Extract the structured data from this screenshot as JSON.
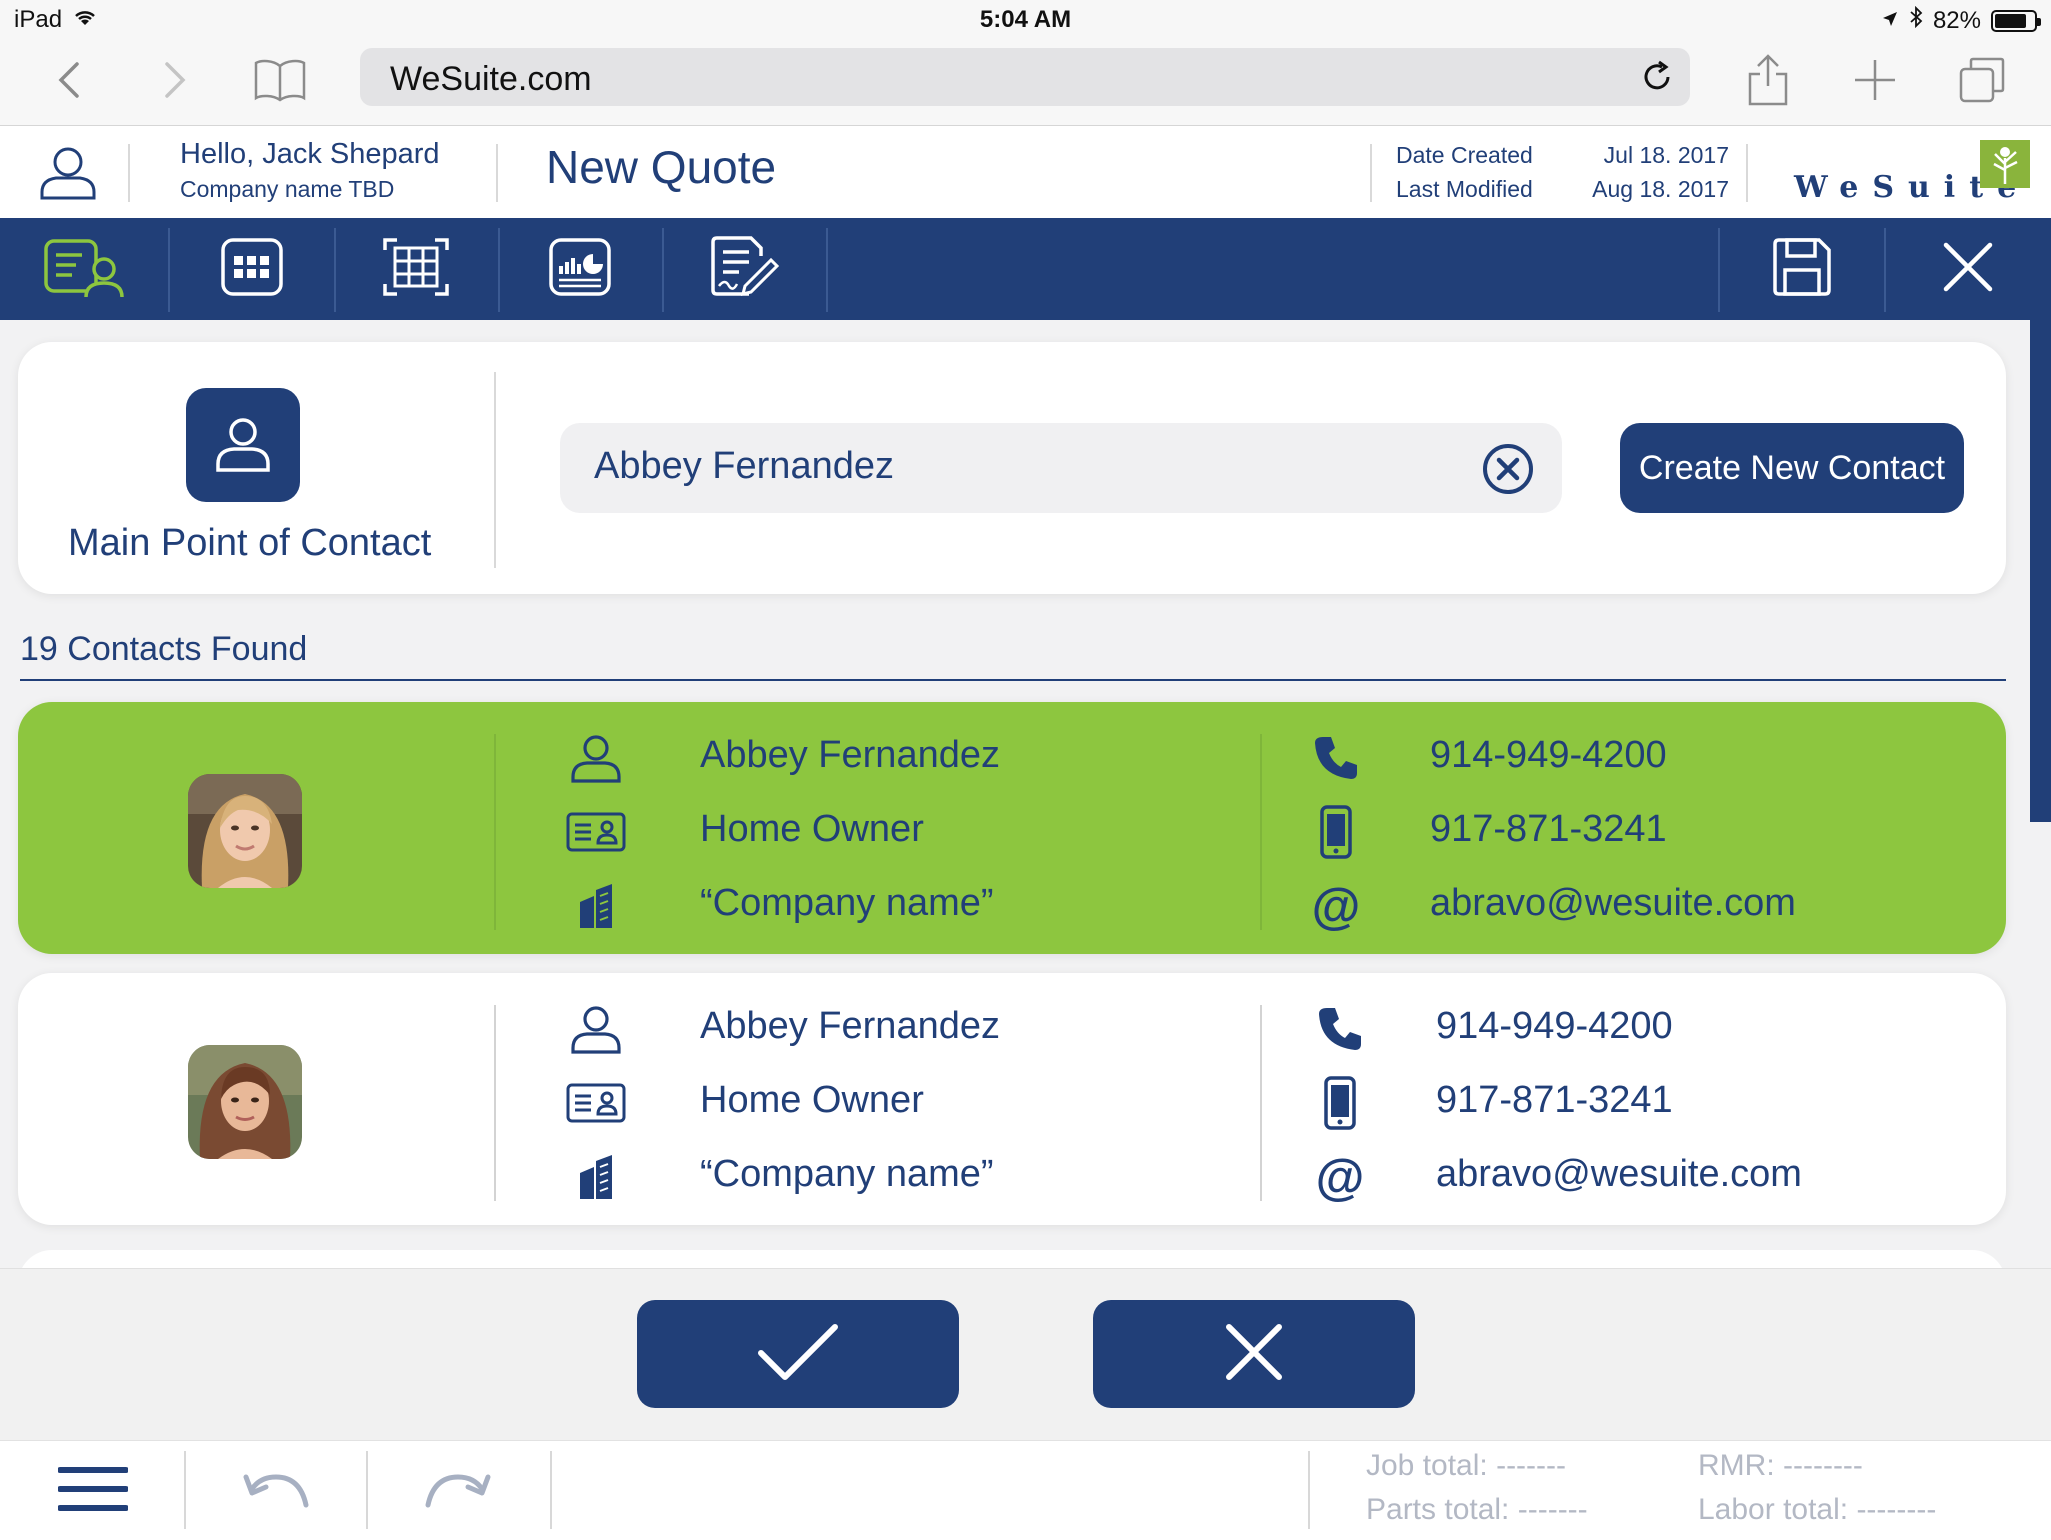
{
  "status_bar": {
    "device": "iPad",
    "time": "5:04 AM",
    "battery": "82%",
    "battery_level": 0.82
  },
  "browser": {
    "url": "WeSuite.com"
  },
  "header": {
    "greeting": "Hello, Jack Shepard",
    "company": "Company name TBD",
    "title": "New Quote",
    "date_created_label": "Date Created",
    "date_created_value": "Jul 18. 2017",
    "last_modified_label": "Last Modified",
    "last_modified_value": "Aug 18. 2017",
    "logo_text": "WeSuite"
  },
  "toolbar": {
    "items": [
      "contact-icon",
      "grid-icon",
      "table-icon",
      "report-icon",
      "sign-document-icon"
    ],
    "save": "save-icon",
    "close": "close-icon"
  },
  "contact_section": {
    "label": "Main Point of Contact",
    "search_value": "Abbey Fernandez",
    "create_button": "Create New Contact"
  },
  "results": {
    "count_text": "19 Contacts Found",
    "contacts": [
      {
        "name": "Abbey Fernandez",
        "role": "Home Owner",
        "company": "“Company name”",
        "phone": "914-949-4200",
        "mobile": "917-871-3241",
        "email": "abravo@wesuite.com",
        "selected": true
      },
      {
        "name": "Abbey Fernandez",
        "role": "Home Owner",
        "company": "“Company name”",
        "phone": "914-949-4200",
        "mobile": "917-871-3241",
        "email": "abravo@wesuite.com",
        "selected": false
      }
    ]
  },
  "footer": {
    "job_total": "Job total: -------",
    "parts_total": "Parts total: -------",
    "rmr": "RMR: --------",
    "labor_total": "Labor total: --------"
  },
  "colors": {
    "navy": "#213f78",
    "selected_green": "#8dc63f",
    "accent_green": "#8ab43c"
  }
}
